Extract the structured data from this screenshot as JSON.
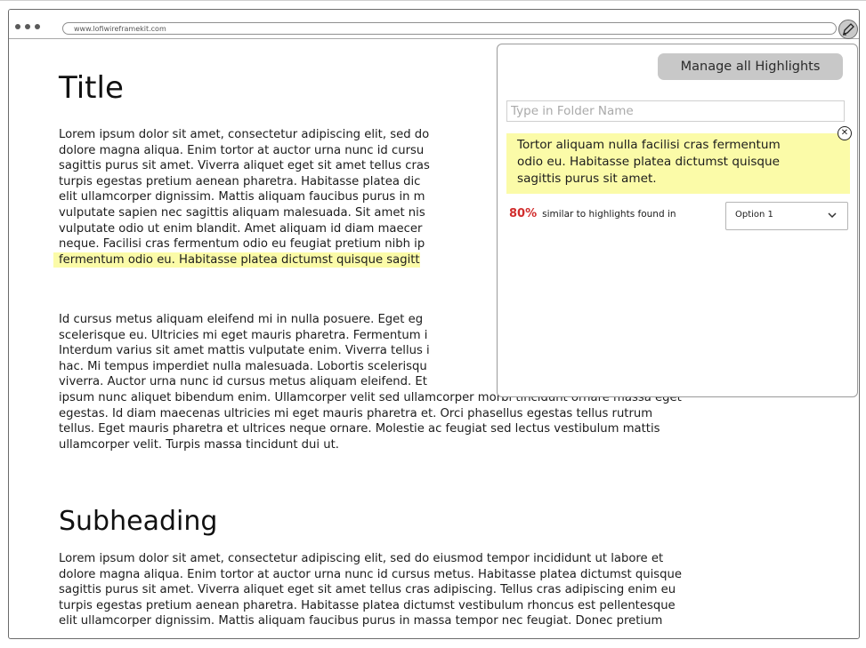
{
  "browser": {
    "url": "www.lofiwireframekit.com"
  },
  "article": {
    "title": "Title",
    "para1": [
      "Lorem ipsum dolor sit amet, consectetur adipiscing elit, sed do",
      "dolore magna aliqua. Enim tortor at auctor urna nunc id cursu",
      "sagittis purus sit amet. Viverra aliquet eget sit amet tellus cras",
      "turpis egestas pretium aenean pharetra. Habitasse platea dic",
      "elit ullamcorper dignissim. Mattis aliquam faucibus purus in m",
      "vulputate sapien nec sagittis aliquam malesuada. Sit amet nis",
      "vulputate odio ut enim blandit. Amet aliquam id diam maecer",
      "neque. Facilisi cras fermentum odio eu feugiat pretium nibh ip"
    ],
    "para1_highlight": "fermentum odio eu. Habitasse platea dictumst quisque sagitt",
    "para2": [
      "Id cursus metus aliquam eleifend mi in nulla posuere. Eget eg",
      "scelerisque eu. Ultricies mi eget mauris pharetra. Fermentum i",
      "Interdum varius sit amet mattis vulputate enim. Viverra tellus i",
      "hac. Mi tempus imperdiet nulla malesuada. Lobortis scelerisqu",
      "viverra. Auctor urna nunc id cursus metus aliquam eleifend. Et",
      "ipsum nunc aliquet bibendum enim. Ullamcorper velit sed ullamcorper morbi tincidunt ornare massa eget",
      "egestas. Id diam maecenas ultricies mi eget mauris pharetra et. Orci phasellus egestas tellus rutrum",
      "tellus. Eget mauris pharetra et ultrices neque ornare. Molestie ac feugiat sed lectus vestibulum mattis",
      "ullamcorper velit. Turpis massa tincidunt dui ut."
    ],
    "subheading": "Subheading",
    "para3": [
      "Lorem ipsum dolor sit amet, consectetur adipiscing elit, sed do eiusmod tempor incididunt ut labore et",
      "dolore magna aliqua. Enim tortor at auctor urna nunc id cursus metus. Habitasse platea dictumst quisque",
      "sagittis purus sit amet. Viverra aliquet eget sit amet tellus cras adipiscing. Tellus cras adipiscing enim eu",
      "turpis egestas pretium aenean pharetra. Habitasse platea dictumst vestibulum rhoncus est pellentesque",
      "elit ullamcorper dignissim. Mattis aliquam faucibus purus in massa tempor nec feugiat. Donec pretium"
    ]
  },
  "panel": {
    "manage_label": "Manage all Highlights",
    "folder_placeholder": "Type in Folder Name",
    "highlight_lines": [
      "Tortor aliquam nulla facilisi cras fermentum",
      "odio eu. Habitasse platea dictumst quisque",
      "sagittis purus sit amet."
    ],
    "similarity_percent": "80%",
    "similarity_text": "similar to highlights found in",
    "select_value": "Option 1"
  },
  "icons": {
    "pen": "pen-icon",
    "close": "close-icon",
    "chevron": "chevron-down-icon"
  },
  "colors": {
    "highlight": "#fbfba8",
    "percent": "#d12d2d",
    "button": "#c8c8c8"
  }
}
